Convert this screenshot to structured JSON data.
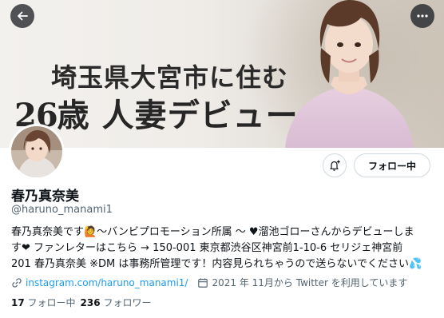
{
  "banner": {
    "line1": "埼玉県大宮市に住む",
    "line2_num": "26",
    "line2_rest": "歳 人妻デビュー"
  },
  "profile": {
    "name": "春乃真奈美",
    "handle": "@haruno_manami1",
    "follow_button": "フォロー中",
    "bio_lines": [
      "春乃真奈美です🙋〜バンビプロモーション所属 〜 ♥溜池ゴローさんからデビューしま",
      "す❤ ファンレターはこちら → 150-001 東京都渋谷区神宮前1-10-6 セリジェ神宮前",
      "201 春乃真奈美 ※DM は事務所管理です！内容見られちゃうので送らないでください💦"
    ],
    "link": "instagram.com/haruno_manami1/",
    "joined": "2021 年 11月から Twitter を利用しています",
    "following_count": "17",
    "following_label": "フォロー中",
    "followers_count": "236",
    "followers_label": "フォロワー"
  },
  "icons": {
    "back": "arrow-left-icon",
    "more": "more-horizontal-icon",
    "notify": "bell-plus-icon",
    "link": "link-icon",
    "calendar": "calendar-icon"
  },
  "colors": {
    "link": "#1d9bf0",
    "secondary_text": "#536471",
    "primary_text": "#0f1419",
    "border": "#cfd9de"
  }
}
